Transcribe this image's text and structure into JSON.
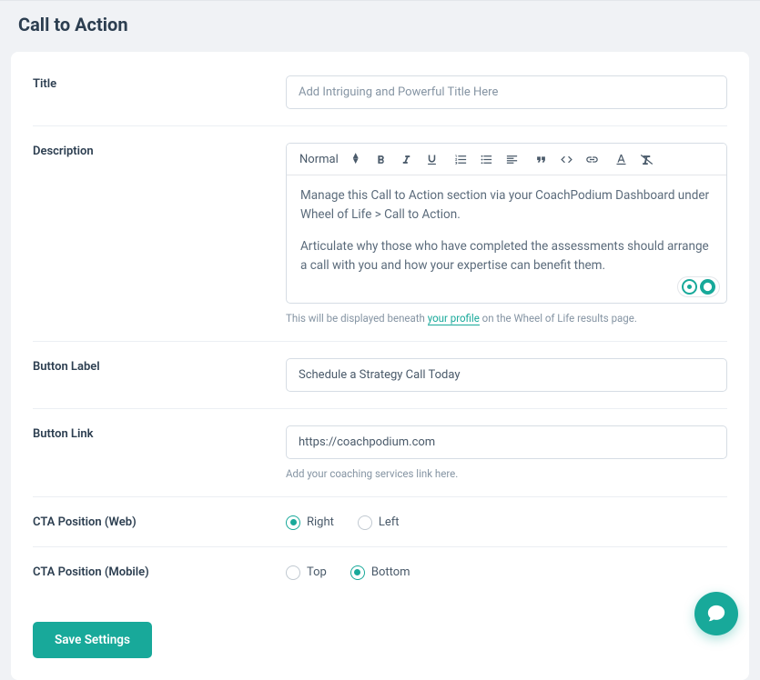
{
  "page": {
    "header": "Call to Action"
  },
  "form": {
    "title_label": "Title",
    "title_placeholder": "Add Intriguing and Powerful Title Here",
    "title_value": "",
    "description_label": "Description",
    "description_p1": "Manage this Call to Action section via your CoachPodium Dashboard under Wheel of Life > Call to Action.",
    "description_p2": "Articulate why those who have completed the assessments should arrange a call with you and how your expertise can benefit them.",
    "description_help_prefix": "This will be displayed beneath ",
    "description_help_link": "your profile",
    "description_help_suffix": " on the Wheel of Life results page.",
    "button_label_label": "Button Label",
    "button_label_value": "Schedule a Strategy Call Today",
    "button_link_label": "Button Link",
    "button_link_value": "https://coachpodium.com",
    "button_link_help": "Add your coaching services link here.",
    "cta_web_label": "CTA Position (Web)",
    "cta_web_options": {
      "right": "Right",
      "left": "Left"
    },
    "cta_web_selected": "right",
    "cta_mobile_label": "CTA Position (Mobile)",
    "cta_mobile_options": {
      "top": "Top",
      "bottom": "Bottom"
    },
    "cta_mobile_selected": "bottom",
    "save_button": "Save Settings"
  },
  "editor": {
    "format_label": "Normal"
  },
  "colors": {
    "accent": "#18a99a"
  }
}
